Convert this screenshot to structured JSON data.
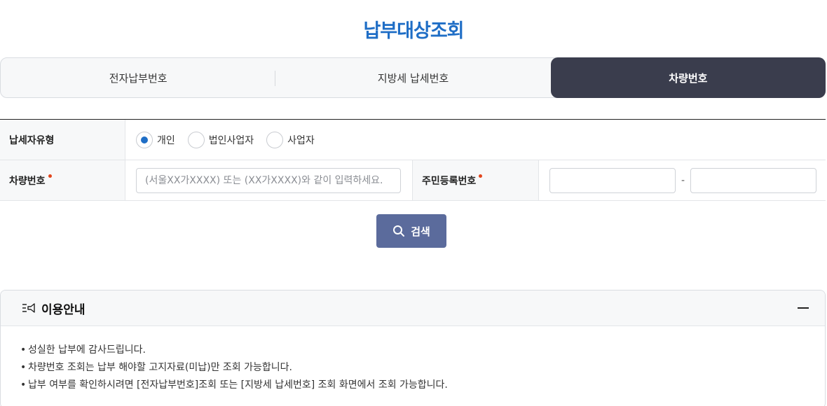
{
  "page": {
    "title": "납부대상조회"
  },
  "tabs": [
    {
      "label": "전자납부번호",
      "active": false
    },
    {
      "label": "지방세 납세번호",
      "active": false
    },
    {
      "label": "차량번호",
      "active": true
    }
  ],
  "form": {
    "taxpayer_type": {
      "label": "납세자유형",
      "options": [
        {
          "label": "개인",
          "selected": true
        },
        {
          "label": "법인사업자",
          "selected": false
        },
        {
          "label": "사업자",
          "selected": false
        }
      ]
    },
    "car_number": {
      "label": "차량번호",
      "placeholder": "(서울XX가XXXX) 또는 (XX가XXXX)와 같이 입력하세요.",
      "value": ""
    },
    "resident_number": {
      "label": "주민등록번호",
      "separator": "-",
      "value_front": "",
      "value_back": ""
    }
  },
  "search_button": {
    "label": "검색"
  },
  "guide": {
    "title": "이용안내",
    "items": [
      "성실한 납부에 감사드립니다.",
      "차량번호 조회는 납부 해야할 고지자료(미납)만 조회 가능합니다.",
      "납부 여부를 확인하시려면 [전자납부번호]조회 또는 [지방세 납세번호] 조회 화면에서 조회 가능합니다."
    ]
  },
  "colors": {
    "accent": "#1f6ec6",
    "tab_active": "#3a3d4d",
    "button": "#5b6b9c",
    "required": "#e2461d"
  }
}
